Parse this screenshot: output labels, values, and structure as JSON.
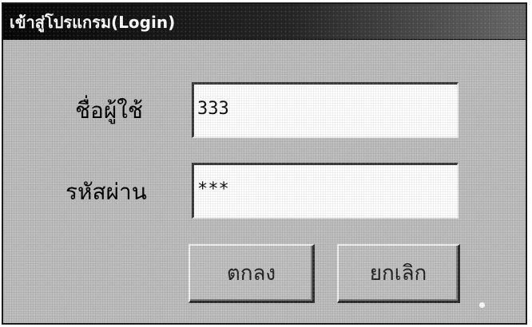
{
  "window": {
    "title": "เข้าสู่โปรแกรม(Login)"
  },
  "form": {
    "username": {
      "label": "ชื่อผู้ใช้",
      "value": "333"
    },
    "password": {
      "label": "รหัสผ่าน",
      "value": "***"
    }
  },
  "buttons": {
    "ok_label": "ตกลง",
    "cancel_label": "ยกเลิก"
  }
}
